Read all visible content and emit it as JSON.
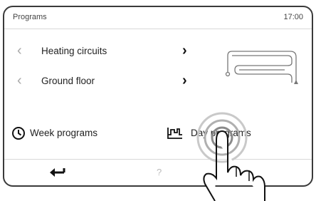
{
  "header": {
    "title": "Programs",
    "time": "17:00"
  },
  "rows": [
    {
      "label": "Heating circuits",
      "prev_icon": "chevron-left",
      "next_icon": "chevron-right"
    },
    {
      "label": "Ground floor",
      "prev_icon": "chevron-left",
      "next_icon": "chevron-right"
    }
  ],
  "programs": {
    "week": {
      "label": "Week programs",
      "icon": "clock-icon"
    },
    "day": {
      "label": "Day programs",
      "icon": "day-chart-icon"
    }
  },
  "footer": {
    "back_icon": "back-arrow-icon",
    "help_label": "?"
  },
  "glyphs": {
    "prev": "‹",
    "next": "›"
  },
  "colors": {
    "border": "#3a3a3a",
    "text": "#222222",
    "muted": "#a8a8a8"
  }
}
